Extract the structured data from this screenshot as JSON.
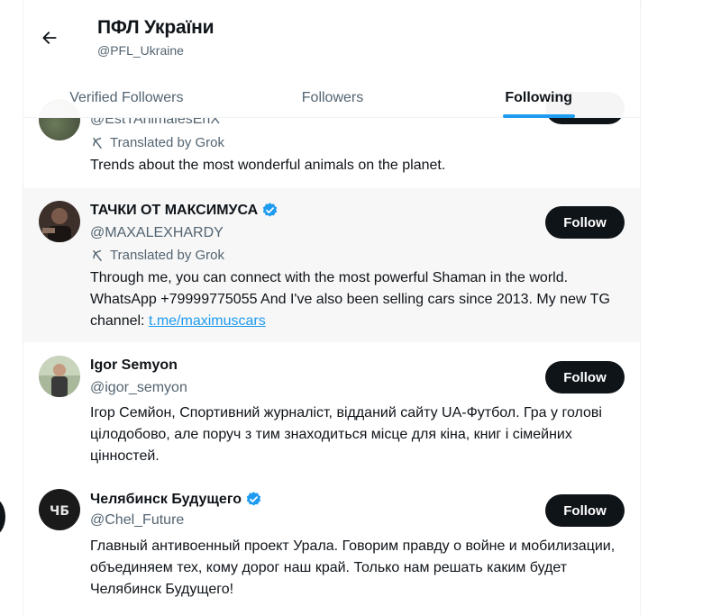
{
  "header": {
    "title": "ПФЛ України",
    "handle": "@PFL_Ukraine",
    "back_icon": "arrow-left-icon"
  },
  "tabs": [
    {
      "label": "Verified Followers",
      "active": false
    },
    {
      "label": "Followers",
      "active": false
    },
    {
      "label": "Following",
      "active": true
    }
  ],
  "accent_color": "#1d9bf0",
  "users": [
    {
      "name": "",
      "handle": "@EstTAnimalesEnX",
      "translated": "Translated by Grok",
      "bio": "Trends about the most wonderful animals on the planet.",
      "follow_label": ""
    },
    {
      "name": "ТАЧКИ ОТ МАКСИМУСА",
      "verified": true,
      "handle": "@MAXALEXHARDY",
      "translated": "Translated by Grok",
      "bio_text": "Through me, you can connect with the most powerful Shaman in the world. WhatsApp +79999775055 And I've also been selling cars since 2013. My new TG channel: ",
      "bio_link": "t.me/maximuscars",
      "follow_label": "Follow"
    },
    {
      "name": "Igor Semyon",
      "verified": false,
      "handle": "@igor_semyon",
      "bio": "Ігор Семйон, Спортивний журналіст, відданий сайту UA-Футбол. Гра у голові цілодобово, але поруч з тим знаходиться місце для кіна, книг і сімейних цінностей.",
      "follow_label": "Follow"
    },
    {
      "name": "Челябинск Будущего",
      "verified": true,
      "handle": "@Chel_Future",
      "bio": "Главный антивоенный проект Урала. Говорим правду о войне и мобилизации, объединяем тех, кому дорог наш край. Только нам решать каким будет Челябинск Будущего!",
      "follow_label": "Follow"
    }
  ]
}
